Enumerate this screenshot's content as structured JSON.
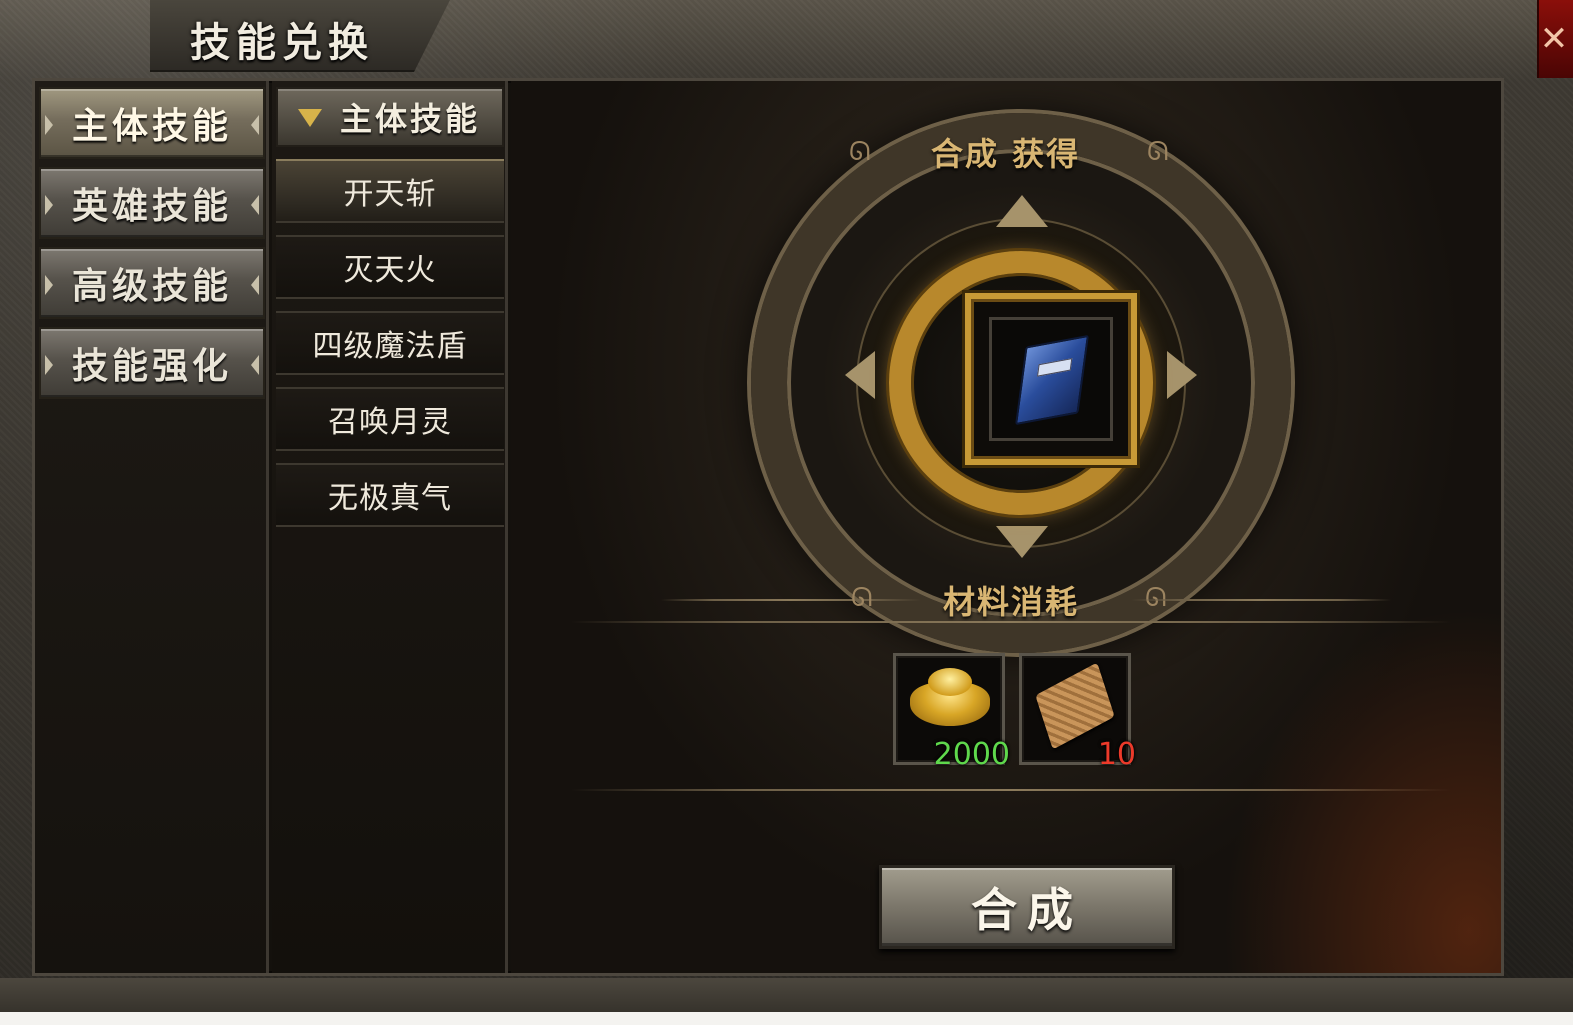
{
  "window": {
    "title": "技能兑换",
    "close_glyph": "✕"
  },
  "categories": [
    {
      "label": "主体技能",
      "active": true
    },
    {
      "label": "英雄技能",
      "active": false
    },
    {
      "label": "高级技能",
      "active": false
    },
    {
      "label": "技能强化",
      "active": false
    }
  ],
  "skill_list": {
    "header": "主体技能",
    "items": [
      {
        "label": "开天斩",
        "active": true
      },
      {
        "label": "灭天火",
        "active": false
      },
      {
        "label": "四级魔法盾",
        "active": false
      },
      {
        "label": "召唤月灵",
        "active": false
      },
      {
        "label": "无极真气",
        "active": false
      }
    ]
  },
  "craft": {
    "result_label": "合成  获得",
    "result_item_icon": "blue-skill-book-icon",
    "materials_label": "材料消耗",
    "materials": [
      {
        "icon": "gold-ingot-icon",
        "count": "2000",
        "count_color": "#5fd84c"
      },
      {
        "icon": "scroll-icon",
        "count": "10",
        "count_color": "#ec3a2a"
      }
    ],
    "button_label": "合成"
  },
  "colors": {
    "gold_text": "#d9b673",
    "sufficient": "#5fd84c",
    "insufficient": "#ec3a2a"
  }
}
